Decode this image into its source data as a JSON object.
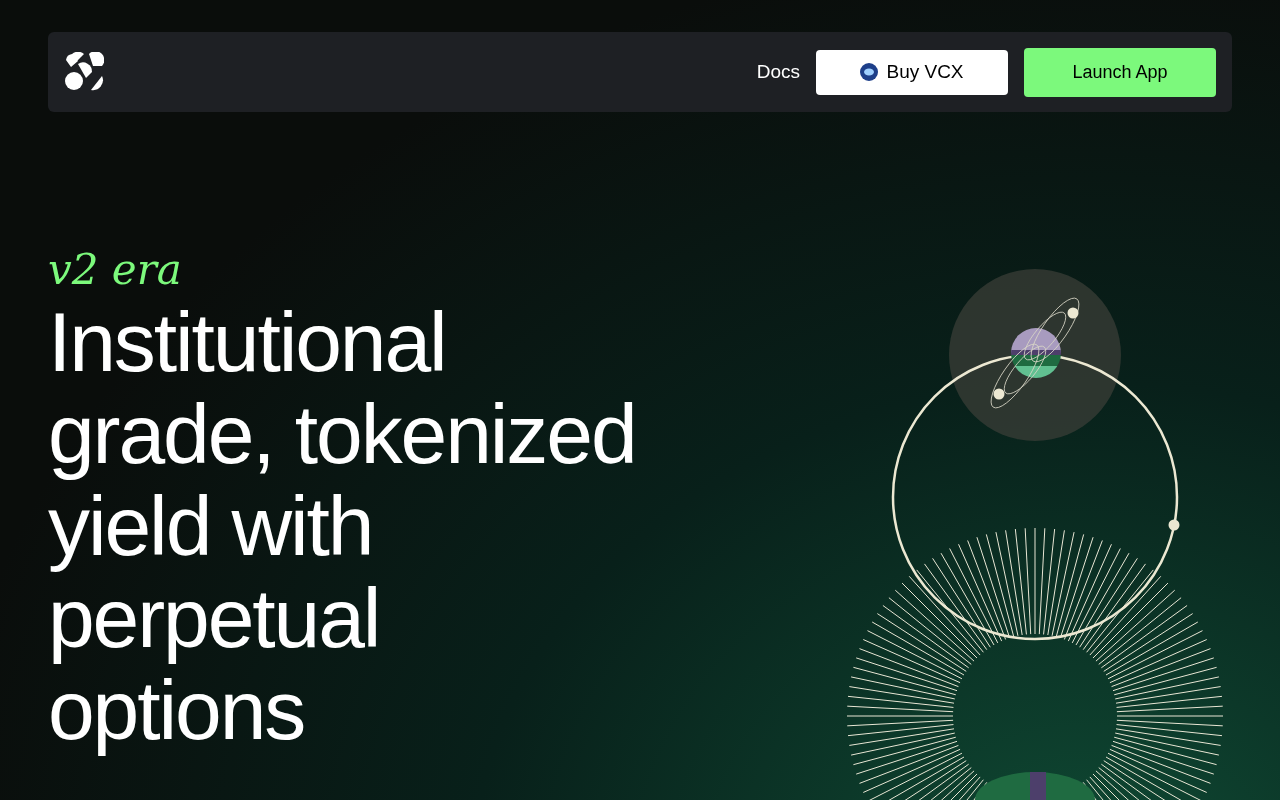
{
  "nav": {
    "links": [
      {
        "label": "Docs"
      }
    ],
    "buttons": [
      {
        "kind": "token",
        "label": "Buy VCX"
      },
      {
        "kind": "primary",
        "label": "Launch App"
      }
    ]
  },
  "hero": {
    "eyebrow": "v2 era",
    "heading": "Institutional grade, tokenized yield with perpetual options"
  }
}
